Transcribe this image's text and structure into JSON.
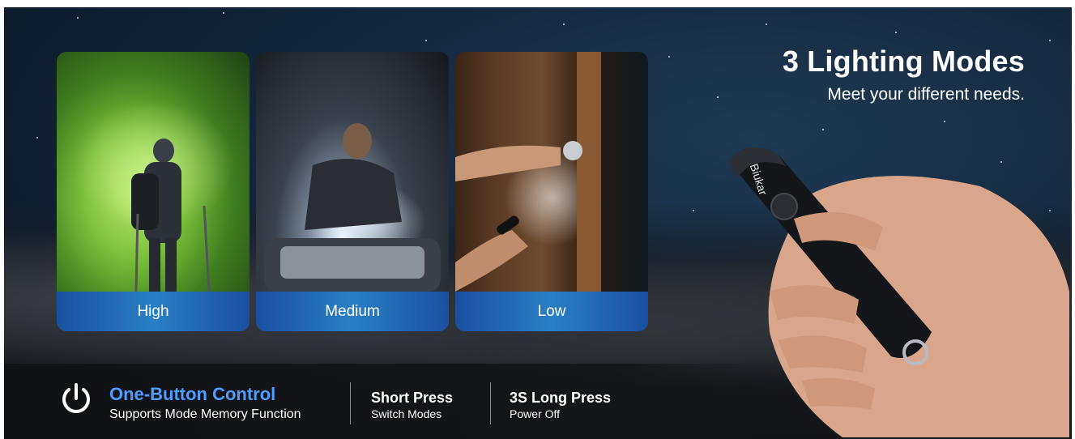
{
  "heading": {
    "title": "3 Lighting Modes",
    "subtitle": "Meet your different needs."
  },
  "modes": [
    {
      "label": "High"
    },
    {
      "label": "Medium"
    },
    {
      "label": "Low"
    }
  ],
  "flashlight": {
    "brand": "Biukar"
  },
  "controls": {
    "title": "One-Button Control",
    "subtitle": "Supports Mode Memory Function",
    "short_press_title": "Short Press",
    "short_press_sub": "Switch Modes",
    "long_press_title": "3S Long Press",
    "long_press_sub": "Power Off",
    "power_icon": "power-icon"
  },
  "colors": {
    "accent_blue": "#4f9dff",
    "label_bar": "#1b4fa0"
  }
}
